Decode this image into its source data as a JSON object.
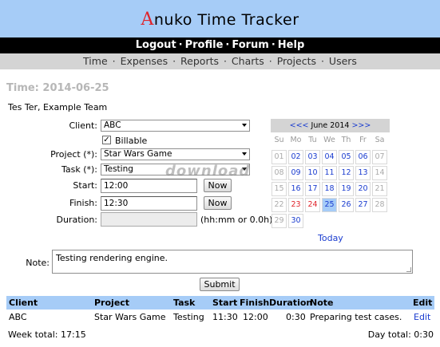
{
  "app": {
    "logo_first": "A",
    "logo_rest": "nuko Time Tracker"
  },
  "top_nav": [
    "Logout",
    "Profile",
    "Forum",
    "Help"
  ],
  "sub_nav": [
    "Time",
    "Expenses",
    "Reports",
    "Charts",
    "Projects",
    "Users"
  ],
  "page_title": "Time: 2014-06-25",
  "user_line": "Tes Ter, Example Team",
  "form": {
    "client_label": "Client:",
    "client_value": "ABC",
    "billable_label": "Billable",
    "billable_checked_mark": "✓",
    "project_label": "Project (*):",
    "project_value": "Star Wars Game",
    "task_label": "Task (*):",
    "task_value": "Testing",
    "start_label": "Start:",
    "start_value": "12:00",
    "finish_label": "Finish:",
    "finish_value": "12:30",
    "duration_label": "Duration:",
    "duration_value": "",
    "duration_hint": "(hh:mm or 0.0h)",
    "now_label": "Now",
    "note_label": "Note:",
    "note_value": "Testing rendering engine.",
    "submit_label": "Submit"
  },
  "calendar": {
    "prev": "<<<",
    "month": "June 2014",
    "next": ">>>",
    "days_of_week": [
      "Su",
      "Mo",
      "Tu",
      "We",
      "Th",
      "Fr",
      "Sa"
    ],
    "weeks": [
      [
        "01",
        "02",
        "03",
        "04",
        "05",
        "06",
        "07"
      ],
      [
        "08",
        "09",
        "10",
        "11",
        "12",
        "13",
        "14"
      ],
      [
        "15",
        "16",
        "17",
        "18",
        "19",
        "20",
        "21"
      ],
      [
        "22",
        "23",
        "24",
        "25",
        "26",
        "27",
        "28"
      ],
      [
        "29",
        "30"
      ]
    ],
    "today_label": "Today",
    "colors": {
      "link": "#1a3ccf",
      "muted": "#aaaaaa",
      "holiday": "#e0232a",
      "selected_bg": "#a6ccf7"
    }
  },
  "table": {
    "headers": [
      "Client",
      "Project",
      "Task",
      "Start",
      "Finish",
      "Duration",
      "Note",
      "Edit"
    ],
    "rows": [
      {
        "client": "ABC",
        "project": "Star Wars Game",
        "task": "Testing",
        "start": "11:30",
        "finish": "12:00",
        "duration": "0:30",
        "note": "Preparing test cases.",
        "edit": "Edit"
      }
    ]
  },
  "totals": {
    "week": "Week total: 17:15",
    "day": "Day total: 0:30"
  },
  "watermark": "download",
  "colors": {
    "header_bg": "#a6ccf7",
    "topnav_bg": "#000000",
    "subnav_bg": "#d4d4d4",
    "logo_accent": "#e0232a"
  }
}
